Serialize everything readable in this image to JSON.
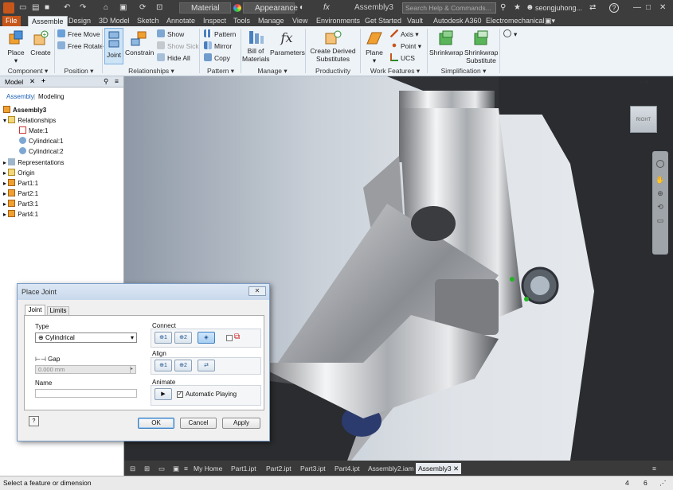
{
  "titlebar": {
    "material_combo": "Material",
    "appearance_combo": "Appearance",
    "document_title": "Assembly3",
    "search_placeholder": "Search Help & Commands...",
    "user_name": "seongjuhong...",
    "help_glyph": "?"
  },
  "ribbon_tabs": [
    "File",
    "Assemble",
    "Design",
    "3D Model",
    "Sketch",
    "Annotate",
    "Inspect",
    "Tools",
    "Manage",
    "View",
    "Environments",
    "Get Started",
    "Vault",
    "Autodesk A360",
    "Electromechanical"
  ],
  "ribbon": {
    "component": {
      "place": "Place",
      "create": "Create",
      "group": "Component"
    },
    "position": {
      "free_move": "Free Move",
      "free_rotate": "Free Rotate",
      "group": "Position"
    },
    "relationships": {
      "joint": "Joint",
      "constrain": "Constrain",
      "show": "Show",
      "show_sick": "Show Sick",
      "hide_all": "Hide All",
      "group": "Relationships"
    },
    "pattern": {
      "pattern": "Pattern",
      "mirror": "Mirror",
      "copy": "Copy",
      "group": "Pattern"
    },
    "manage": {
      "bom_line1": "Bill of",
      "bom_line2": "Materials",
      "parameters": "Parameters",
      "group": "Manage"
    },
    "productivity": {
      "line1": "Create Derived",
      "line2": "Substitutes",
      "group": "Productivity"
    },
    "work_features": {
      "plane": "Plane",
      "axis": "Axis",
      "point": "Point",
      "ucs": "UCS",
      "group": "Work Features"
    },
    "simplification": {
      "shrinkwrap": "Shrinkwrap",
      "sw_sub1": "Shrinkwrap",
      "sw_sub2": "Substitute",
      "group": "Simplification"
    }
  },
  "browser": {
    "title": "Model",
    "mode_assembly": "Assembly",
    "mode_modeling": "Modeling",
    "root": "Assembly3",
    "relationships": "Relationships",
    "mate": "Mate:1",
    "cyl1": "Cylindrical:1",
    "cyl2": "Cylindrical:2",
    "representations": "Representations",
    "origin": "Origin",
    "parts": [
      "Part1:1",
      "Part2:1",
      "Part3:1",
      "Part4:1"
    ]
  },
  "viewcube_label": "RIGHT",
  "doc_tabs": [
    "My Home",
    "Part1.ipt",
    "Part2.ipt",
    "Part3.ipt",
    "Part4.ipt",
    "Assembly2.iam",
    "Assembly3"
  ],
  "status": {
    "message": "Select a feature or dimension",
    "count_a": "4",
    "count_b": "6"
  },
  "dialog": {
    "title": "Place Joint",
    "tab_joint": "Joint",
    "tab_limits": "Limits",
    "type_label": "Type",
    "type_value": "Cylindrical",
    "gap_label": "Gap",
    "gap_value": "0.000 mm",
    "name_label": "Name",
    "connect_label": "Connect",
    "align_label": "Align",
    "animate_label": "Animate",
    "auto_play": "Automatic Playing",
    "ok": "OK",
    "cancel": "Cancel",
    "apply": "Apply"
  },
  "colors": {
    "file_tab": "#c7561b",
    "ribbon_bg": "#eef3f8",
    "dark_chrome": "#3d3d3d"
  }
}
